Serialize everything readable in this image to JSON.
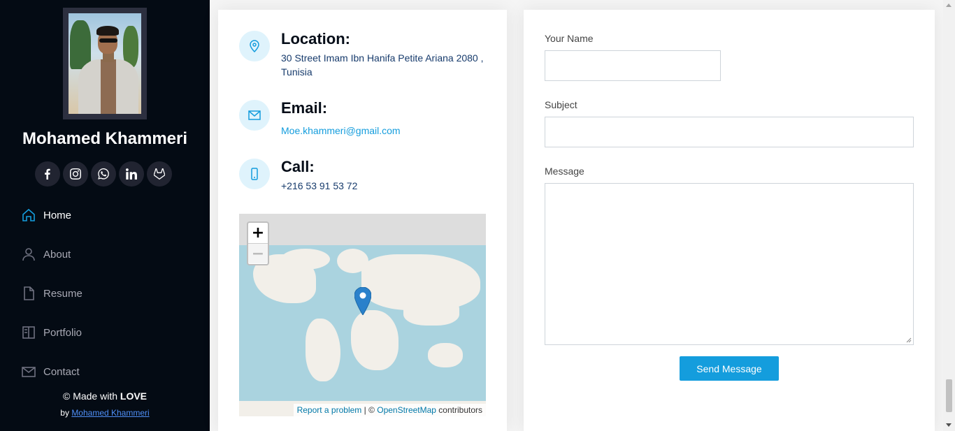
{
  "sidebar": {
    "name": "Mohamed Khammeri",
    "socials": [
      "facebook-icon",
      "instagram-icon",
      "whatsapp-icon",
      "linkedin-icon",
      "gitlab-icon"
    ],
    "nav": [
      {
        "label": "Home",
        "icon": "home-icon",
        "active": true
      },
      {
        "label": "About",
        "icon": "person-icon",
        "active": false
      },
      {
        "label": "Resume",
        "icon": "file-icon",
        "active": false
      },
      {
        "label": "Portfolio",
        "icon": "book-half-icon",
        "active": false
      },
      {
        "label": "Contact",
        "icon": "envelope-icon",
        "active": false
      }
    ],
    "footer": {
      "prefix": "© Made with ",
      "love": "LOVE",
      "by": "by ",
      "author": "Mohamed Khammeri"
    }
  },
  "info": {
    "location_title": "Location:",
    "location_text": "30 Street Imam Ibn Hanifa Petite Ariana 2080 , Tunisia",
    "email_title": "Email:",
    "email_text": "Moe.khammeri@gmail.com",
    "call_title": "Call:",
    "call_text": "+216 53 91 53 72",
    "map": {
      "zoom_in": "+",
      "zoom_out": "−",
      "report": "Report a problem",
      "separator": " | © ",
      "osm": "OpenStreetMap",
      "contributors": " contributors"
    }
  },
  "form": {
    "name_label": "Your Name",
    "subject_label": "Subject",
    "message_label": "Message",
    "name_value": "",
    "subject_value": "",
    "message_value": "",
    "send_label": "Send Message"
  },
  "colors": {
    "accent": "#149ddd",
    "sidebar_bg": "#040b14",
    "heading": "#050d18"
  }
}
